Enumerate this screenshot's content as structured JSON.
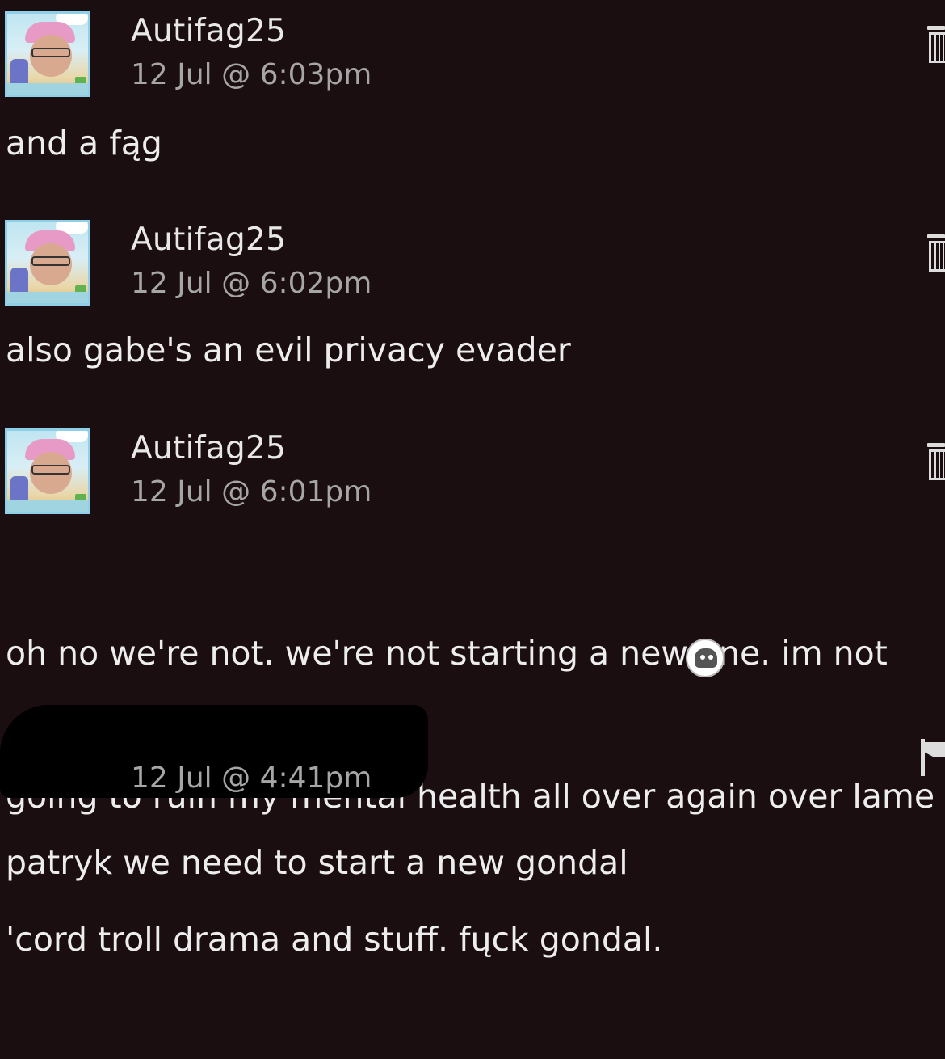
{
  "comments": [
    {
      "username": "Autifag25",
      "timestamp": "12 Jul @ 6:03pm",
      "text": "and a fąg",
      "action_icon": "trash-icon"
    },
    {
      "username": "Autifag25",
      "timestamp": "12 Jul @ 6:02pm",
      "text": "also gabe's an evil privacy evader",
      "action_icon": "trash-icon"
    },
    {
      "username": "Autifag25",
      "timestamp": "12 Jul @ 6:01pm",
      "text_lines": [
        "oh no we're not. we're not starting a new one. im not",
        "going to ruin my mental health all over again over lame",
        "'cord troll drama and stuff. fųck gondal."
      ],
      "emoticon": "emoticon-icon",
      "action_icon": "trash-icon"
    },
    {
      "username": "",
      "timestamp": "12 Jul @ 4:41pm",
      "text": "patryk we need to start a new gondal",
      "action_icon": "flag-icon"
    }
  ],
  "colors": {
    "background": "#1a0e10",
    "username": "#e8e8e8",
    "timestamp": "#a6a6a6",
    "text": "#ededed"
  }
}
